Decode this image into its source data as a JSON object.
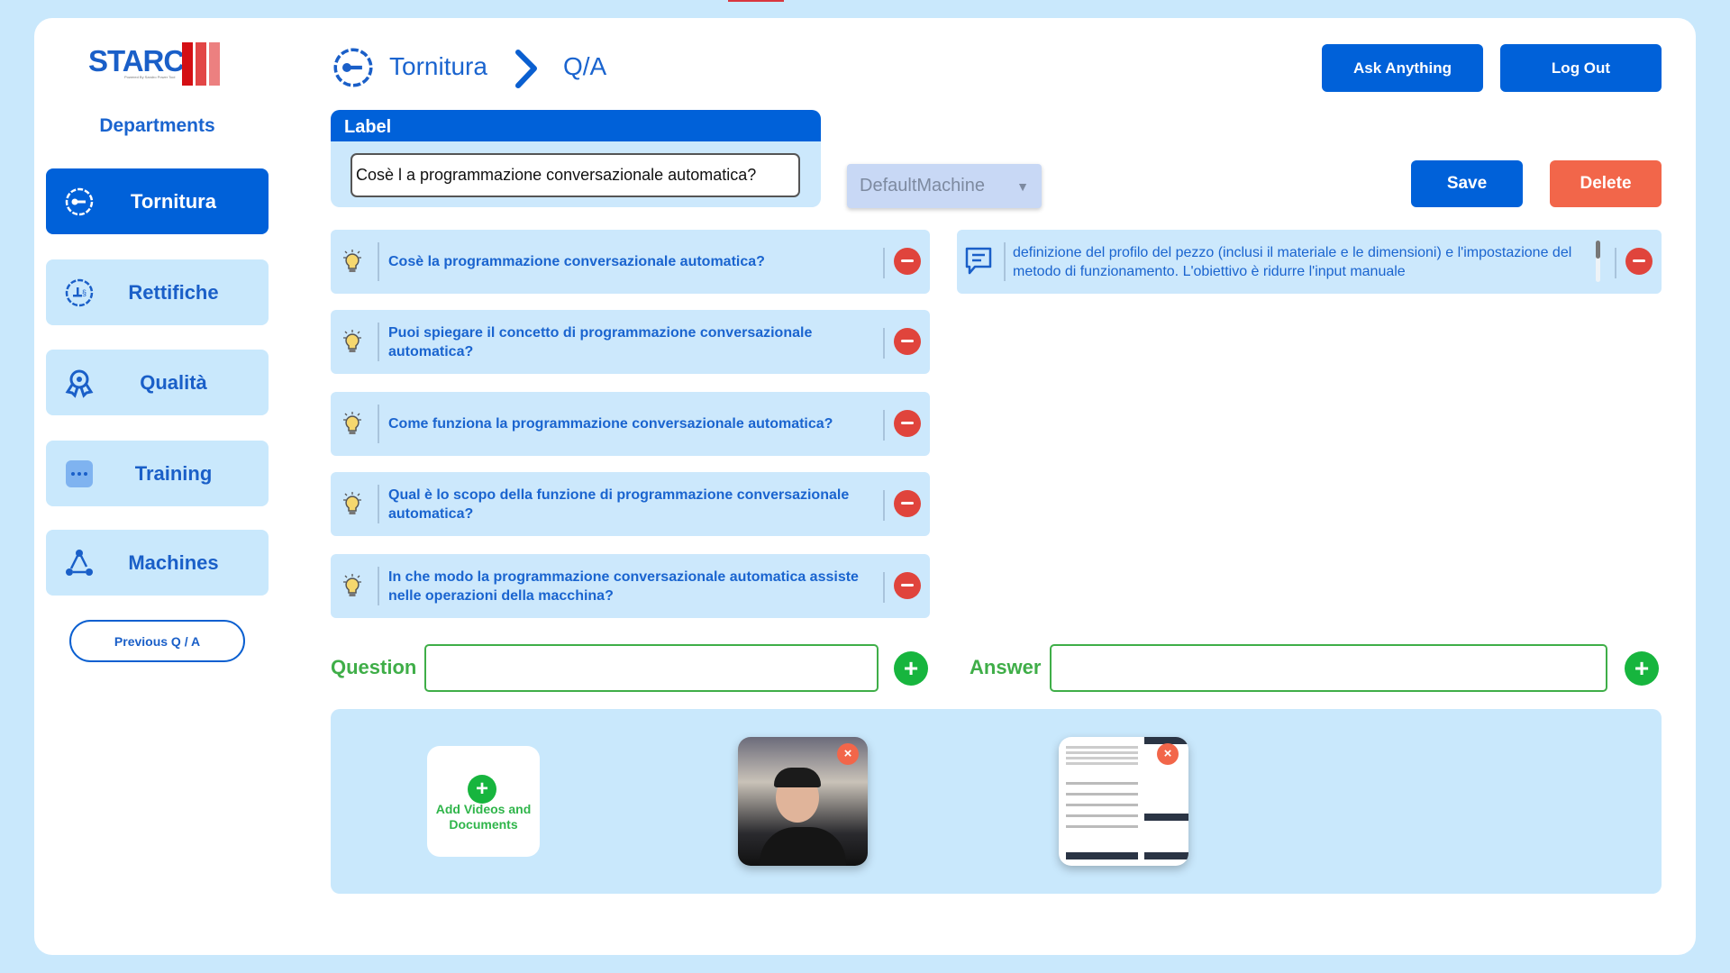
{
  "colors": {
    "primary": "#0061d9",
    "background": "#c9e8fc",
    "danger": "#f2664a",
    "success": "#17b53e"
  },
  "logo": {
    "text": "STARC",
    "tagline": "Powered By Sandro Power Tool"
  },
  "sidebar": {
    "heading": "Departments",
    "items": [
      {
        "label": "Tornitura",
        "icon": "gear-key-icon",
        "active": true
      },
      {
        "label": "Rettifiche",
        "icon": "gear-grinder-icon"
      },
      {
        "label": "Qualità",
        "icon": "award-badge-icon"
      },
      {
        "label": "Training",
        "icon": "more-dots-icon"
      },
      {
        "label": "Machines",
        "icon": "network-triangle-icon"
      }
    ],
    "previous_qa": "Previous Q / A"
  },
  "breadcrumb": {
    "department": "Tornitura",
    "page": "Q/A"
  },
  "header": {
    "ask_anything": "Ask Anything",
    "log_out": "Log Out"
  },
  "label_card": {
    "title": "Label",
    "value": "Cosè l a programmazione conversazionale automatica?"
  },
  "machine_select": {
    "value": "DefaultMachine"
  },
  "actions": {
    "save": "Save",
    "delete": "Delete"
  },
  "questions": [
    "Cosè la programmazione conversazionale automatica?",
    "Puoi spiegare il concetto di programmazione conversazionale automatica?",
    "Come funziona la programmazione conversazionale automatica?",
    "Qual è lo scopo della funzione di programmazione conversazionale automatica?",
    "In che modo la programmazione conversazionale automatica assiste nelle operazioni della macchina?"
  ],
  "answer": "definizione del profilo del pezzo (inclusi il materiale e le dimensioni) e l'impostazione del metodo di funzionamento. L'obiettivo è ridurre l'input manuale",
  "form": {
    "question_label": "Question",
    "answer_label": "Answer",
    "question_value": "",
    "answer_value": ""
  },
  "media": {
    "add_label": "Add Videos and Documents",
    "items": [
      {
        "type": "video"
      },
      {
        "type": "document"
      }
    ]
  }
}
